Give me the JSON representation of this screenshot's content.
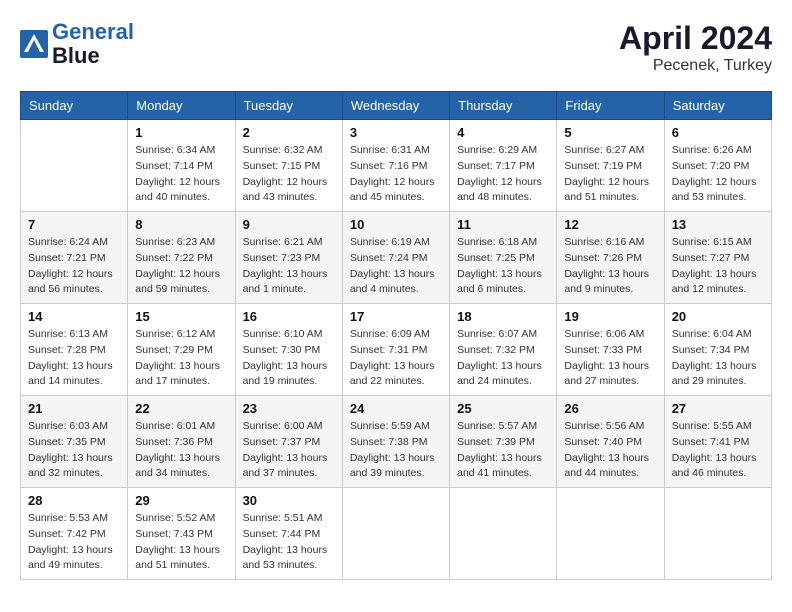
{
  "header": {
    "logo_line1": "General",
    "logo_line2": "Blue",
    "month_title": "April 2024",
    "location": "Pecenek, Turkey"
  },
  "weekdays": [
    "Sunday",
    "Monday",
    "Tuesday",
    "Wednesday",
    "Thursday",
    "Friday",
    "Saturday"
  ],
  "weeks": [
    [
      {
        "day": "",
        "sunrise": "",
        "sunset": "",
        "daylight": ""
      },
      {
        "day": "1",
        "sunrise": "Sunrise: 6:34 AM",
        "sunset": "Sunset: 7:14 PM",
        "daylight": "Daylight: 12 hours and 40 minutes."
      },
      {
        "day": "2",
        "sunrise": "Sunrise: 6:32 AM",
        "sunset": "Sunset: 7:15 PM",
        "daylight": "Daylight: 12 hours and 43 minutes."
      },
      {
        "day": "3",
        "sunrise": "Sunrise: 6:31 AM",
        "sunset": "Sunset: 7:16 PM",
        "daylight": "Daylight: 12 hours and 45 minutes."
      },
      {
        "day": "4",
        "sunrise": "Sunrise: 6:29 AM",
        "sunset": "Sunset: 7:17 PM",
        "daylight": "Daylight: 12 hours and 48 minutes."
      },
      {
        "day": "5",
        "sunrise": "Sunrise: 6:27 AM",
        "sunset": "Sunset: 7:19 PM",
        "daylight": "Daylight: 12 hours and 51 minutes."
      },
      {
        "day": "6",
        "sunrise": "Sunrise: 6:26 AM",
        "sunset": "Sunset: 7:20 PM",
        "daylight": "Daylight: 12 hours and 53 minutes."
      }
    ],
    [
      {
        "day": "7",
        "sunrise": "Sunrise: 6:24 AM",
        "sunset": "Sunset: 7:21 PM",
        "daylight": "Daylight: 12 hours and 56 minutes."
      },
      {
        "day": "8",
        "sunrise": "Sunrise: 6:23 AM",
        "sunset": "Sunset: 7:22 PM",
        "daylight": "Daylight: 12 hours and 59 minutes."
      },
      {
        "day": "9",
        "sunrise": "Sunrise: 6:21 AM",
        "sunset": "Sunset: 7:23 PM",
        "daylight": "Daylight: 13 hours and 1 minute."
      },
      {
        "day": "10",
        "sunrise": "Sunrise: 6:19 AM",
        "sunset": "Sunset: 7:24 PM",
        "daylight": "Daylight: 13 hours and 4 minutes."
      },
      {
        "day": "11",
        "sunrise": "Sunrise: 6:18 AM",
        "sunset": "Sunset: 7:25 PM",
        "daylight": "Daylight: 13 hours and 6 minutes."
      },
      {
        "day": "12",
        "sunrise": "Sunrise: 6:16 AM",
        "sunset": "Sunset: 7:26 PM",
        "daylight": "Daylight: 13 hours and 9 minutes."
      },
      {
        "day": "13",
        "sunrise": "Sunrise: 6:15 AM",
        "sunset": "Sunset: 7:27 PM",
        "daylight": "Daylight: 13 hours and 12 minutes."
      }
    ],
    [
      {
        "day": "14",
        "sunrise": "Sunrise: 6:13 AM",
        "sunset": "Sunset: 7:28 PM",
        "daylight": "Daylight: 13 hours and 14 minutes."
      },
      {
        "day": "15",
        "sunrise": "Sunrise: 6:12 AM",
        "sunset": "Sunset: 7:29 PM",
        "daylight": "Daylight: 13 hours and 17 minutes."
      },
      {
        "day": "16",
        "sunrise": "Sunrise: 6:10 AM",
        "sunset": "Sunset: 7:30 PM",
        "daylight": "Daylight: 13 hours and 19 minutes."
      },
      {
        "day": "17",
        "sunrise": "Sunrise: 6:09 AM",
        "sunset": "Sunset: 7:31 PM",
        "daylight": "Daylight: 13 hours and 22 minutes."
      },
      {
        "day": "18",
        "sunrise": "Sunrise: 6:07 AM",
        "sunset": "Sunset: 7:32 PM",
        "daylight": "Daylight: 13 hours and 24 minutes."
      },
      {
        "day": "19",
        "sunrise": "Sunrise: 6:06 AM",
        "sunset": "Sunset: 7:33 PM",
        "daylight": "Daylight: 13 hours and 27 minutes."
      },
      {
        "day": "20",
        "sunrise": "Sunrise: 6:04 AM",
        "sunset": "Sunset: 7:34 PM",
        "daylight": "Daylight: 13 hours and 29 minutes."
      }
    ],
    [
      {
        "day": "21",
        "sunrise": "Sunrise: 6:03 AM",
        "sunset": "Sunset: 7:35 PM",
        "daylight": "Daylight: 13 hours and 32 minutes."
      },
      {
        "day": "22",
        "sunrise": "Sunrise: 6:01 AM",
        "sunset": "Sunset: 7:36 PM",
        "daylight": "Daylight: 13 hours and 34 minutes."
      },
      {
        "day": "23",
        "sunrise": "Sunrise: 6:00 AM",
        "sunset": "Sunset: 7:37 PM",
        "daylight": "Daylight: 13 hours and 37 minutes."
      },
      {
        "day": "24",
        "sunrise": "Sunrise: 5:59 AM",
        "sunset": "Sunset: 7:38 PM",
        "daylight": "Daylight: 13 hours and 39 minutes."
      },
      {
        "day": "25",
        "sunrise": "Sunrise: 5:57 AM",
        "sunset": "Sunset: 7:39 PM",
        "daylight": "Daylight: 13 hours and 41 minutes."
      },
      {
        "day": "26",
        "sunrise": "Sunrise: 5:56 AM",
        "sunset": "Sunset: 7:40 PM",
        "daylight": "Daylight: 13 hours and 44 minutes."
      },
      {
        "day": "27",
        "sunrise": "Sunrise: 5:55 AM",
        "sunset": "Sunset: 7:41 PM",
        "daylight": "Daylight: 13 hours and 46 minutes."
      }
    ],
    [
      {
        "day": "28",
        "sunrise": "Sunrise: 5:53 AM",
        "sunset": "Sunset: 7:42 PM",
        "daylight": "Daylight: 13 hours and 49 minutes."
      },
      {
        "day": "29",
        "sunrise": "Sunrise: 5:52 AM",
        "sunset": "Sunset: 7:43 PM",
        "daylight": "Daylight: 13 hours and 51 minutes."
      },
      {
        "day": "30",
        "sunrise": "Sunrise: 5:51 AM",
        "sunset": "Sunset: 7:44 PM",
        "daylight": "Daylight: 13 hours and 53 minutes."
      },
      {
        "day": "",
        "sunrise": "",
        "sunset": "",
        "daylight": ""
      },
      {
        "day": "",
        "sunrise": "",
        "sunset": "",
        "daylight": ""
      },
      {
        "day": "",
        "sunrise": "",
        "sunset": "",
        "daylight": ""
      },
      {
        "day": "",
        "sunrise": "",
        "sunset": "",
        "daylight": ""
      }
    ]
  ]
}
